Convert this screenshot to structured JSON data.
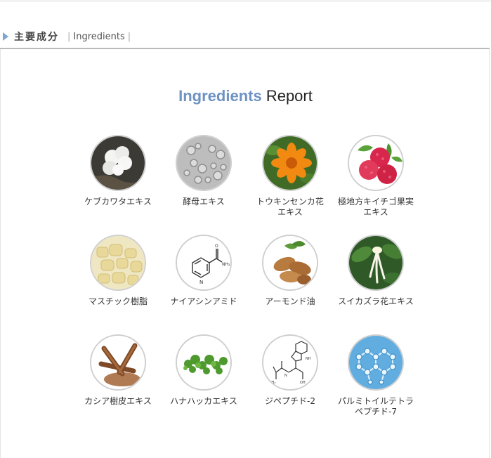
{
  "header": {
    "title_jp": "主要成分",
    "title_en": "Ingredients"
  },
  "report": {
    "title_part1": "Ingredients",
    "title_part2": "Report"
  },
  "ingredients": [
    {
      "label": "ケブカワタエキス",
      "icon": "cotton-icon"
    },
    {
      "label": "酵母エキス",
      "icon": "yeast-icon"
    },
    {
      "label": "トウキンセンカ花\nエキス",
      "icon": "calendula-icon"
    },
    {
      "label": "極地方キイチゴ果実\nエキス",
      "icon": "raspberry-icon"
    },
    {
      "label": "マスチック樹脂",
      "icon": "mastic-icon"
    },
    {
      "label": "ナイアシンアミド",
      "icon": "niacinamide-icon"
    },
    {
      "label": "アーモンド油",
      "icon": "almond-icon"
    },
    {
      "label": "スイカズラ花エキス",
      "icon": "honeysuckle-icon"
    },
    {
      "label": "カシア樹皮エキス",
      "icon": "cinnamon-icon"
    },
    {
      "label": "ハナハッカエキス",
      "icon": "oregano-icon"
    },
    {
      "label": "ジペプチド-2",
      "icon": "dipeptide-icon"
    },
    {
      "label": "パルミトイルテトラ\nペプチド-7",
      "icon": "peptide-icon"
    }
  ]
}
